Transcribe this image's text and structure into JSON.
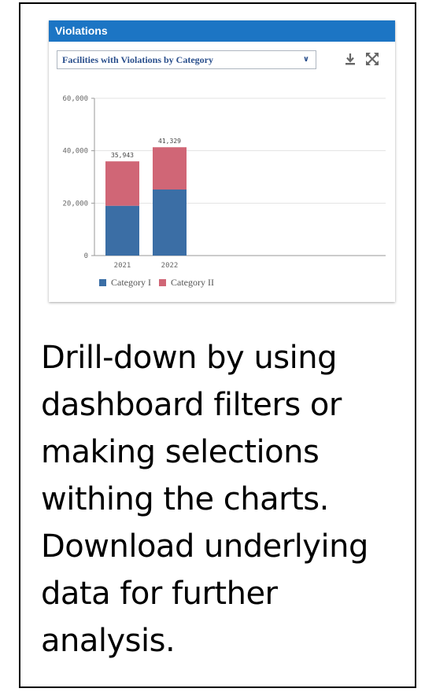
{
  "widget": {
    "title": "Violations",
    "selector_value": "Facilities with Violations by Category",
    "download_icon": "download-icon",
    "expand_icon": "expand-icon"
  },
  "colors": {
    "header": "#1c75c4",
    "category_1": "#3b6ea5",
    "category_2": "#d06676"
  },
  "chart_data": {
    "type": "bar",
    "stacked": true,
    "categories": [
      "2021",
      "2022"
    ],
    "series": [
      {
        "name": "Category I",
        "values": [
          19000,
          25200
        ]
      },
      {
        "name": "Category II",
        "values": [
          16943,
          16129
        ]
      }
    ],
    "totals": [
      "35,943",
      "41,329"
    ],
    "y_ticks": [
      "0",
      "20,000",
      "40,000",
      "60,000"
    ],
    "ylim": [
      0,
      60000
    ],
    "grid": true,
    "legend": "bottom-left",
    "title": "",
    "xlabel": "",
    "ylabel": ""
  },
  "caption": {
    "lines": [
      "Drill-down by using",
      "dashboard filters or",
      "making selections",
      "withing the charts.",
      "Download underlying",
      "data for further",
      "analysis."
    ]
  }
}
